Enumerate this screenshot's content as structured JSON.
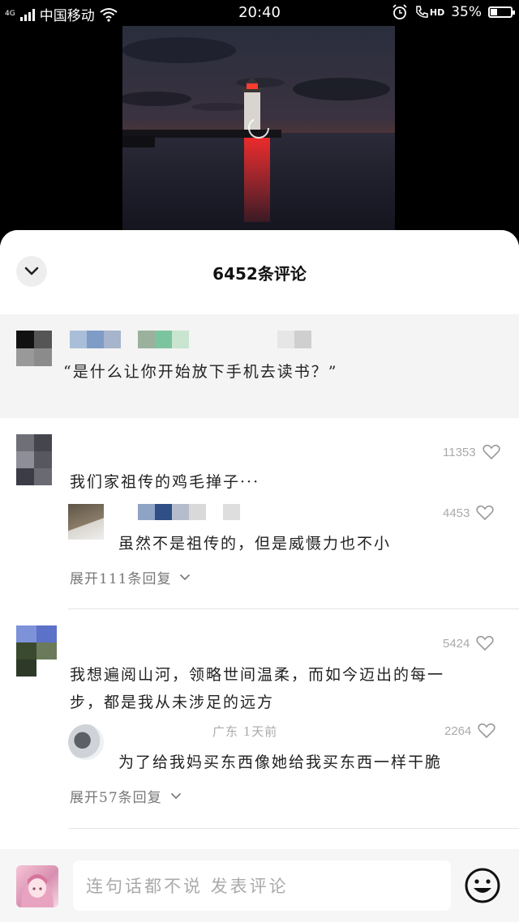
{
  "status_bar": {
    "network": "4G",
    "carrier": "中国移动",
    "time": "20:40",
    "hd": "HD",
    "battery": "35%",
    "battery_level": 0.35
  },
  "comments_panel": {
    "title": "6452条评论",
    "pinned_quote": "“是什么让你开始放下手机去读书？”",
    "comments": [
      {
        "text": "我们家祖传的鸡毛掸子···",
        "likes": "11353",
        "reply": {
          "text": "虽然不是祖传的，但是威慑力也不小",
          "likes": "4453"
        },
        "expand_label": "展开111条回复"
      },
      {
        "text_line1": "我想遍阅山河，领略世间温柔，而如今迈出的每一",
        "text_line2": "步，都是我从未涉足的远方",
        "likes": "5424",
        "reply": {
          "meta": "广东 1天前",
          "text": "为了给我妈买东西像她给我买东西一样干脆",
          "likes": "2264"
        },
        "expand_label": "展开57条回复"
      }
    ]
  },
  "composer": {
    "placeholder": "连句话都不说 发表评论"
  },
  "icons": {
    "collapse": "chevron-down-icon",
    "like": "heart-icon",
    "expand": "chevron-down-icon",
    "emoji": "smiley-icon"
  },
  "colors": {
    "sunset": "#e0561a",
    "light_beam": "#ff2a2a",
    "panel_bg": "#ffffff",
    "pinned_bg": "#f4f4f4"
  }
}
